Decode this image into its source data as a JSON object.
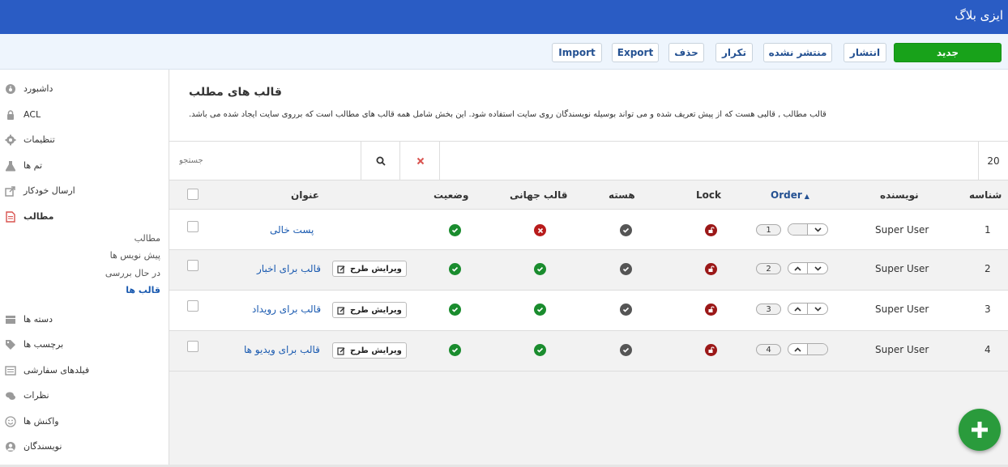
{
  "app": {
    "title": "ایزی بلاگ"
  },
  "toolbar": {
    "new_label": "جدید",
    "publish_label": "انتشار",
    "unpublish_label": "منتشر نشده",
    "duplicate_label": "تکرار",
    "delete_label": "حذف",
    "export_label": "Export",
    "import_label": "Import"
  },
  "sidebar": {
    "items": [
      {
        "label": "داشبورد",
        "icon": "dashboard-icon"
      },
      {
        "label": "ACL",
        "icon": "lock-icon"
      },
      {
        "label": "تنظیمات",
        "icon": "gear-icon"
      },
      {
        "label": "تم ها",
        "icon": "flask-icon"
      },
      {
        "label": "ارسال خودکار",
        "icon": "share-icon"
      },
      {
        "label": "مطالب",
        "icon": "document-icon"
      },
      {
        "label": "دسته ها",
        "icon": "folder-icon"
      },
      {
        "label": "برچسب ها",
        "icon": "tags-icon"
      },
      {
        "label": "فیلدهای سفارشی",
        "icon": "list-icon"
      },
      {
        "label": "نظرات",
        "icon": "comments-icon"
      },
      {
        "label": "واکنش ها",
        "icon": "smile-icon"
      },
      {
        "label": "نویسندگان",
        "icon": "user-icon"
      }
    ],
    "sub_items": [
      {
        "label": "مطالب"
      },
      {
        "label": "پیش نویس ها"
      },
      {
        "label": "در حال بررسی"
      },
      {
        "label": "قالب ها"
      }
    ]
  },
  "page": {
    "title": "قالب های مطلب",
    "description": "قالب مطالب , قالبی هست که از پیش تعریف شده و می تواند بوسیله نویسندگان روی سایت استفاده شود. این بخش شامل همه قالب های مطالب است که برروی سایت ایجاد شده می باشد."
  },
  "search": {
    "placeholder": "جستجو",
    "limit": "20"
  },
  "table": {
    "headers": {
      "title": "عنوان",
      "status": "وضعیت",
      "global": "قالب جهانی",
      "core": "هسته",
      "lock": "Lock",
      "order": "Order",
      "author": "نویسنده",
      "id": "شناسه"
    },
    "edit_label": "ویرایش طرح",
    "rows": [
      {
        "id": "1",
        "title": "پست خالی",
        "author": "Super User",
        "order": "1",
        "global": "no",
        "has_edit": false,
        "up": false,
        "down": true
      },
      {
        "id": "2",
        "title": "قالب برای اخبار",
        "author": "Super User",
        "order": "2",
        "global": "yes",
        "has_edit": true,
        "up": true,
        "down": true
      },
      {
        "id": "3",
        "title": "قالب برای رویداد",
        "author": "Super User",
        "order": "3",
        "global": "yes",
        "has_edit": true,
        "up": true,
        "down": true
      },
      {
        "id": "4",
        "title": "قالب برای ویدیو ها",
        "author": "Super User",
        "order": "4",
        "global": "yes",
        "has_edit": true,
        "up": true,
        "down": false
      }
    ]
  },
  "colors": {
    "topbar": "#2a5cc4",
    "new_button": "#18a21a",
    "link": "#1a5ab0",
    "success": "#1a8c2e",
    "danger": "#b81b1b",
    "fab": "#2a9b3c"
  }
}
